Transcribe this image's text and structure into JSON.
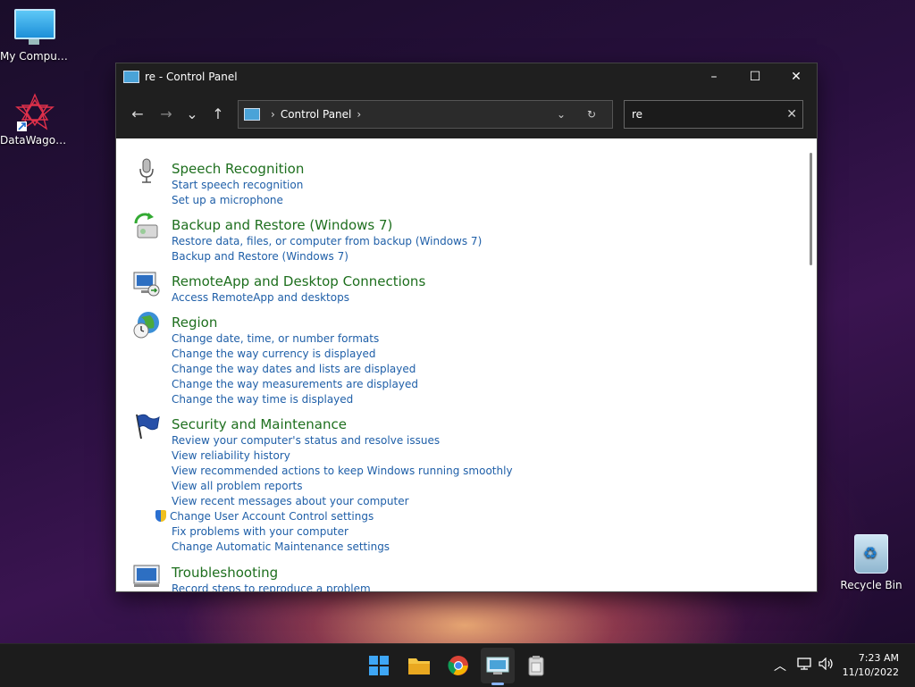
{
  "desktop": {
    "icons": [
      {
        "label": "My Computer"
      },
      {
        "label": "DataWagon..."
      },
      {
        "label": "Recycle Bin"
      }
    ]
  },
  "window": {
    "title": "re - Control Panel",
    "controls": {
      "minimize": "–",
      "maximize": "☐",
      "close": "✕"
    }
  },
  "nav": {
    "back": "←",
    "forward": "→",
    "recent": "⌄",
    "up": "↑"
  },
  "address": {
    "separator": "›",
    "crumb": "Control Panel",
    "dropdown": "⌄",
    "refresh": "↻"
  },
  "search": {
    "value": "re",
    "clear": "✕"
  },
  "results": [
    {
      "title": "Speech Recognition",
      "icon": "microphone-icon",
      "links": [
        "Start speech recognition",
        "Set up a microphone"
      ]
    },
    {
      "title": "Backup and Restore (Windows 7)",
      "icon": "backup-restore-icon",
      "links": [
        "Restore data, files, or computer from backup (Windows 7)",
        "Backup and Restore (Windows 7)"
      ]
    },
    {
      "title": "RemoteApp and Desktop Connections",
      "icon": "remote-desktop-icon",
      "links": [
        "Access RemoteApp and desktops"
      ]
    },
    {
      "title": "Region",
      "icon": "globe-clock-icon",
      "links": [
        "Change date, time, or number formats",
        "Change the way currency is displayed",
        "Change the way dates and lists are displayed",
        "Change the way measurements are displayed",
        "Change the way time is displayed"
      ]
    },
    {
      "title": "Security and Maintenance",
      "icon": "flag-icon",
      "links": [
        "Review your computer's status and resolve issues",
        "View reliability history",
        "View recommended actions to keep Windows running smoothly",
        "View all problem reports",
        "View recent messages about your computer",
        "Change User Account Control settings",
        "Fix problems with your computer",
        "Change Automatic Maintenance settings"
      ]
    },
    {
      "title": "Troubleshooting",
      "icon": "troubleshooting-icon",
      "links": [
        "Record steps to reproduce a problem"
      ]
    }
  ],
  "taskbar": {
    "tray_chevron": "︿",
    "time": "7:23 AM",
    "date": "11/10/2022"
  }
}
